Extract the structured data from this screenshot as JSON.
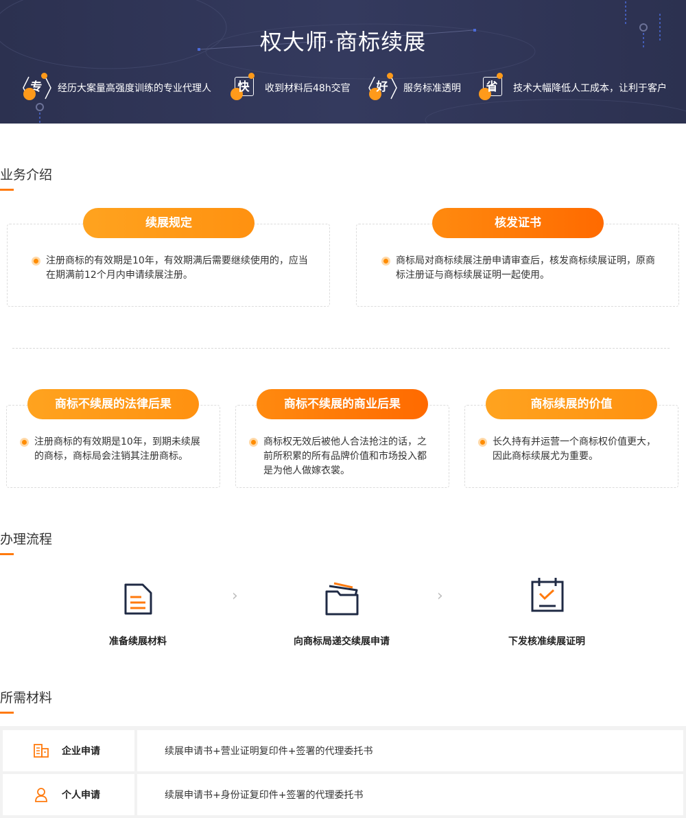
{
  "banner": {
    "title": "权大师·商标续展",
    "features": [
      {
        "glyph": "专",
        "text": "经历大案量高强度训练的专业代理人"
      },
      {
        "glyph": "快",
        "text": "收到材料后48h交官"
      },
      {
        "glyph": "好",
        "text": "服务标准透明"
      },
      {
        "glyph": "省",
        "text": "技术大幅降低人工成本，让利于客户"
      }
    ]
  },
  "intro": {
    "title": "业务介绍",
    "cards_top": [
      {
        "title": "续展规定",
        "text_line1": "注册商标的有效期是10年，有效期满后需要继续使用的，应当",
        "text_line2": "在期满前12个月内申请续展注册。"
      },
      {
        "title": "核发证书",
        "text_line1": "商标局对商标续展注册申请审查后，核发商标续展证明，原商",
        "text_line2": "标注册证与商标续展证明一起使用。"
      }
    ],
    "cards_bottom": [
      {
        "title": "商标不续展的法律后果",
        "text_line1": "注册商标的有效期是10年，到期未续展",
        "text_line2": "的商标，商标局会注销其注册商标。",
        "text_line3": ""
      },
      {
        "title": "商标不续展的商业后果",
        "text_line1": "商标权无效后被他人合法抢注的话，之",
        "text_line2": "前所积累的所有品牌价值和市场投入都",
        "text_line3": "是为他人做嫁衣裳。"
      },
      {
        "title": "商标续展的价值",
        "text_line1": "长久持有并运营一个商标权价值更大，",
        "text_line2": "因此商标续展尤为重要。",
        "text_line3": ""
      }
    ]
  },
  "process": {
    "title": "办理流程",
    "steps": [
      {
        "label": "准备续展材料",
        "icon": "document-icon"
      },
      {
        "label": "向商标局递交续展申请",
        "icon": "folder-icon"
      },
      {
        "label": "下发核准续展证明",
        "icon": "calendar-check-icon"
      }
    ],
    "separator": "›"
  },
  "materials": {
    "title": "所需材料",
    "rows": [
      {
        "type": "企业申请",
        "icon": "building-icon",
        "desc": "续展申请书+营业证明复印件+签署的代理委托书"
      },
      {
        "type": "个人申请",
        "icon": "person-icon",
        "desc": "续展申请书+身份证复印件+签署的代理委托书"
      }
    ]
  },
  "colors": {
    "accent": "#ff7a0d",
    "banner_bg": "#2f3454",
    "pill_light": "#ff9a14",
    "pill_dark": "#ff7000"
  }
}
